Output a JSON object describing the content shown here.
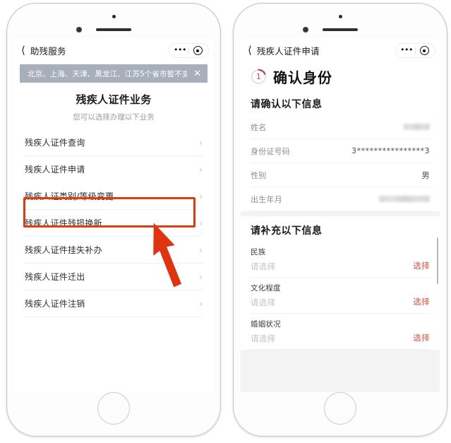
{
  "left_phone": {
    "navbar": {
      "back_icon": "chevron-left-icon",
      "title": "助残服务",
      "menu_icon": "more-dots-icon",
      "target_icon": "target-circle-icon"
    },
    "banner": {
      "text": "北京、上海、天津、黑龙江、江苏5个省市暂不支",
      "close_label": "✕",
      "background_color": "#a7afbd",
      "text_color": "#ffffff"
    },
    "page_head": {
      "title": "残疾人证件业务",
      "subtitle": "您可以选择办理以下业务"
    },
    "services": [
      {
        "label": "残疾人证件查询",
        "chevron": "›",
        "highlighted": false
      },
      {
        "label": "残疾人证件申请",
        "chevron": "›",
        "highlighted": true
      },
      {
        "label": "残疾人证类别/等级变更",
        "chevron": "›",
        "highlighted": false
      },
      {
        "label": "残疾人证件残损换新",
        "chevron": "›",
        "highlighted": false
      },
      {
        "label": "残疾人证件挂失补办",
        "chevron": "›",
        "highlighted": false
      },
      {
        "label": "残疾人证件迁出",
        "chevron": "›",
        "highlighted": false
      },
      {
        "label": "残疾人证件注销",
        "chevron": "›",
        "highlighted": false
      }
    ],
    "annotation": {
      "highlight_color": "#e03c12",
      "arrow_color": "#e03312",
      "arrow_points_to": "残疾人证件申请"
    }
  },
  "right_phone": {
    "navbar": {
      "back_icon": "chevron-left-icon",
      "title": "残疾人证件申请",
      "menu_icon": "more-dots-icon",
      "target_icon": "target-circle-icon"
    },
    "step": {
      "number": "1",
      "title": "确认身份",
      "ring_color": "#b9455c",
      "ring_track_color": "#f0d4da"
    },
    "confirm_section": {
      "title": "请确认以下信息",
      "rows": [
        {
          "label": "姓名",
          "value": "",
          "masked": true,
          "mask_width": "name"
        },
        {
          "label": "身份证号码",
          "value": "3****************3",
          "masked": false
        },
        {
          "label": "性别",
          "value": "男",
          "masked": false
        },
        {
          "label": "出生年月",
          "value": "",
          "masked": true,
          "mask_width": "date"
        }
      ]
    },
    "supplement_section": {
      "title": "请补充以下信息",
      "rows": [
        {
          "label": "民族",
          "placeholder": "请选择",
          "action": "选择"
        },
        {
          "label": "文化程度",
          "placeholder": "请选择",
          "action": "选择"
        },
        {
          "label": "婚姻状况",
          "placeholder": "请选择",
          "action": "选择"
        }
      ],
      "action_color": "#d9503f"
    }
  }
}
